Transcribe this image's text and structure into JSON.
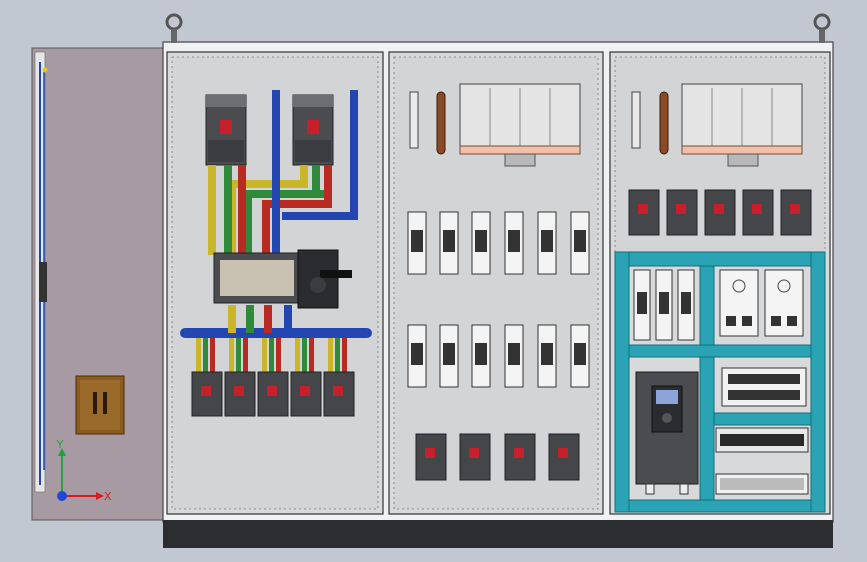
{
  "viewport": {
    "background_top": "#c9cfd8",
    "background_bottom": "#b9c0cb"
  },
  "cabinet": {
    "panel_color": "#d4d6d8",
    "frame_color": "#f2f3f4",
    "base_color": "#2b2d30",
    "door_color": "#a99ba3",
    "cyan_trunking": "#2aa4b4",
    "sections": [
      "incoming-distribution",
      "feeder-breakers",
      "control-vfd"
    ]
  },
  "busbar_colors": {
    "phase_a": "#c9b62a",
    "phase_b": "#2f8a3a",
    "phase_c": "#b72b22",
    "neutral": "#2346b0"
  },
  "triad": {
    "x_label": "X",
    "y_label": "Y",
    "x_color": "#d21e1e",
    "y_color": "#18a83a",
    "z_color": "#2346d8"
  },
  "vfd": {
    "display_color": "#8ca4d8"
  }
}
